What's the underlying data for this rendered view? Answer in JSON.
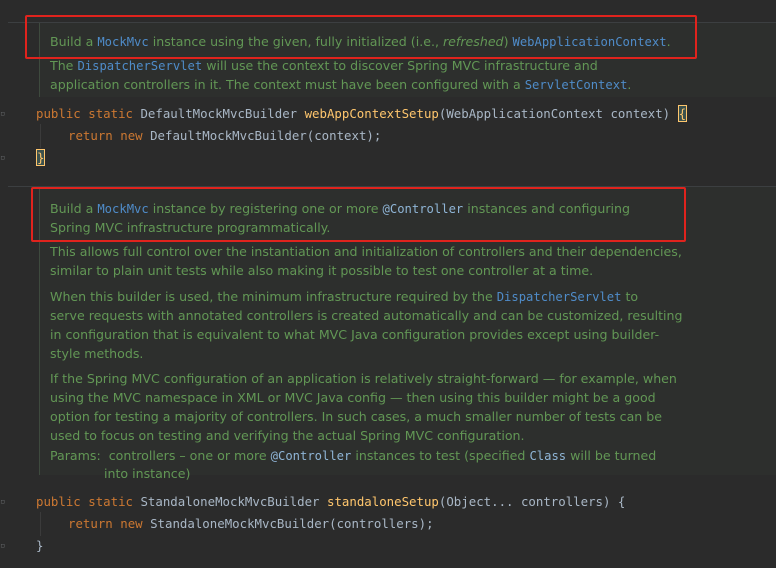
{
  "doc1": {
    "line1": {
      "t1": "Build a ",
      "link_mockmvc": "MockMvc",
      "t2": " instance using the given, fully initialized (i.e., ",
      "refreshed": "refreshed",
      "t3": ") ",
      "link_wac": "WebApplicationContext",
      "t4": "."
    },
    "p2": {
      "t1": "The ",
      "link_dispatcher": "DispatcherServlet",
      "t2": " will use the context to discover Spring MVC infrastructure and",
      "t3": "application controllers in it. The context must have been configured with a ",
      "link_servletcontext": "ServletContext",
      "t4": "."
    }
  },
  "method1": {
    "kw_public": "public",
    "kw_static": "static",
    "return_type": "DefaultMockMvcBuilder",
    "name": "webAppContextSetup",
    "params": "(WebApplicationContext context) ",
    "brace_open": "{",
    "kw_return": "return",
    "kw_new": "new",
    "body_rest": "DefaultMockMvcBuilder(context);",
    "brace_close": "}"
  },
  "doc2": {
    "p1": {
      "t1": "Build a ",
      "link_mockmvc": "MockMvc",
      "t2": " instance by registering one or more ",
      "code_controller": "@Controller",
      "t3": " instances and configuring",
      "line2": "Spring MVC infrastructure programmatically."
    },
    "p2": {
      "line1": "This allows full control over the instantiation and initialization of controllers and their dependencies,",
      "line2": "similar to plain unit tests while also making it possible to test one controller at a time."
    },
    "p3": {
      "t1": "When this builder is used, the minimum infrastructure required by the ",
      "link_dispatcher": "DispatcherServlet",
      "t2": " to",
      "line2": "serve requests with annotated controllers is created automatically and can be customized, resulting",
      "line3": "in configuration that is equivalent to what MVC Java configuration provides except using builder-",
      "line4": "style methods."
    },
    "p4": {
      "line1": "If the Spring MVC configuration of an application is relatively straight-forward — for example, when",
      "line2": "using the MVC namespace in XML or MVC Java config — then using this builder might be a good",
      "line3": "option for testing a majority of controllers. In such cases, a much smaller number of tests can be",
      "line4": "used to focus on testing and verifying the actual Spring MVC configuration."
    },
    "params": {
      "label": "Params:",
      "t1": "controllers – one or more ",
      "code_controller": "@Controller",
      "t2": " instances to test (specified ",
      "code_class": "Class",
      "t3": " will be turned",
      "line2": "into instance)"
    }
  },
  "method2": {
    "kw_public": "public",
    "kw_static": "static",
    "return_type": "StandaloneMockMvcBuilder",
    "name": "standaloneSetup",
    "params": "(Object... controllers) {",
    "kw_return": "return",
    "kw_new": "new",
    "body_rest": "StandaloneMockMvcBuilder(controllers);",
    "brace_close": "}"
  },
  "colors": {
    "background": "#2b2b2b",
    "doc_text": "#629755",
    "link": "#4f8cc9",
    "keyword": "#cc7832",
    "method_name": "#ffc66d",
    "highlight_box": "#e0231d"
  }
}
